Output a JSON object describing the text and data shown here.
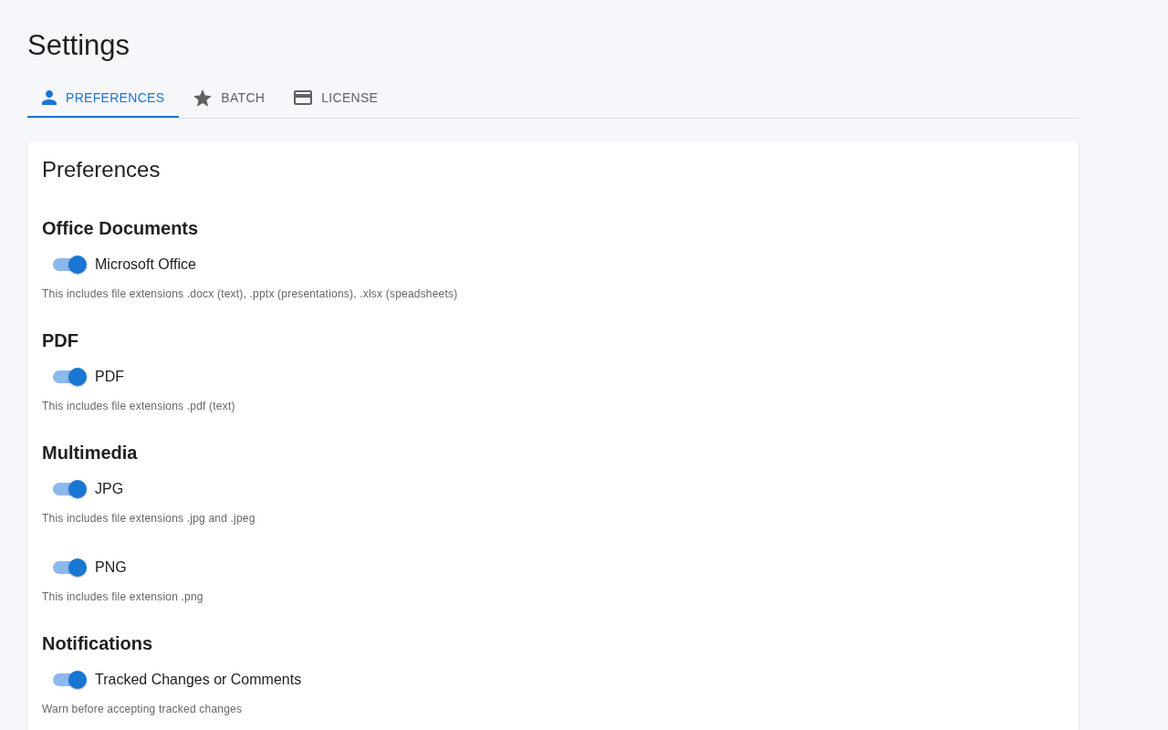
{
  "title": "Settings",
  "tabs": [
    {
      "label": "PREFERENCES",
      "selected": true
    },
    {
      "label": "BATCH",
      "selected": false
    },
    {
      "label": "LICENSE",
      "selected": false
    }
  ],
  "panel": {
    "title": "Preferences",
    "sections": [
      {
        "heading": "Office Documents",
        "options": [
          {
            "label": "Microsoft Office",
            "on": true,
            "description": "This includes file extensions .docx (text), .pptx (presentations), .xlsx (speadsheets)"
          }
        ]
      },
      {
        "heading": "PDF",
        "options": [
          {
            "label": "PDF",
            "on": true,
            "description": "This includes file extensions .pdf (text)"
          }
        ]
      },
      {
        "heading": "Multimedia",
        "options": [
          {
            "label": "JPG",
            "on": true,
            "description": "This includes file extensions .jpg and .jpeg"
          },
          {
            "label": "PNG",
            "on": true,
            "description": "This includes file extension .png"
          }
        ]
      },
      {
        "heading": "Notifications",
        "options": [
          {
            "label": "Tracked Changes or Comments",
            "on": true,
            "description": "Warn before accepting tracked changes"
          }
        ]
      }
    ]
  }
}
